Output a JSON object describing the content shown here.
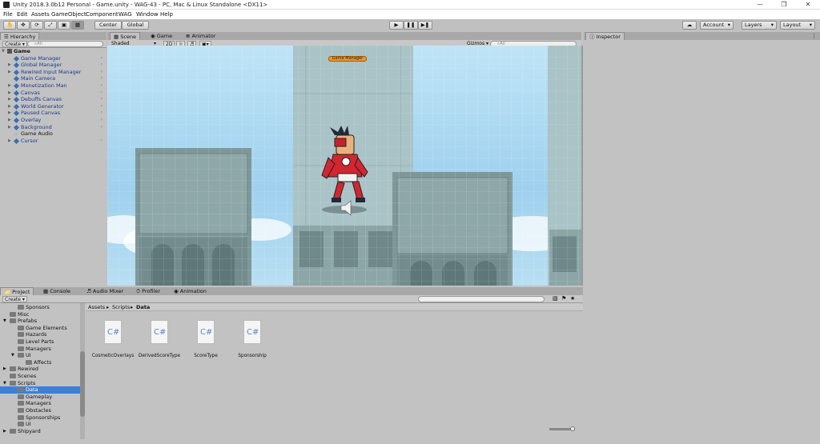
{
  "window": {
    "title": "Unity 2018.3.0b12 Personal - Game.unity - WAG-43 - PC, Mac & Linux Standalone <DX11>"
  },
  "menu": [
    "File",
    "Edit",
    "Assets",
    "GameObject",
    "Component",
    "WAG",
    "Window",
    "Help"
  ],
  "toolbar": {
    "center_label": "Center",
    "global_label": "Global",
    "account_label": "Account",
    "layers_label": "Layers",
    "layout_label": "Layout"
  },
  "hierarchy": {
    "tab": "Hierarchy",
    "create_label": "Create",
    "search_placeholder": "⌕All",
    "root": "Game",
    "items": [
      {
        "label": "Game Manager",
        "arrow": false
      },
      {
        "label": "Global Manager",
        "arrow": true
      },
      {
        "label": "Rewired Input Manager",
        "arrow": true
      },
      {
        "label": "Main Camera",
        "arrow": false
      },
      {
        "label": "Monetization Man",
        "arrow": true
      },
      {
        "label": "Canvas",
        "arrow": true
      },
      {
        "label": "Debuffs Canvas",
        "arrow": true
      },
      {
        "label": "World Generator",
        "arrow": true
      },
      {
        "label": "Paused Canvas",
        "arrow": true
      },
      {
        "label": "Overlay",
        "arrow": true
      },
      {
        "label": "Background",
        "arrow": true
      },
      {
        "label": "Game Audio",
        "arrow": false
      },
      {
        "label": "Cursor",
        "arrow": true
      }
    ]
  },
  "scene": {
    "tabs": [
      "Scene",
      "Game",
      "Animator"
    ],
    "shading": "Shaded",
    "mode_2d": "2D",
    "gizmos_label": "Gizmos",
    "search_placeholder": "⌕All",
    "game_manager_label": "Game Manager"
  },
  "inspector": {
    "tab": "Inspector"
  },
  "project": {
    "tabs": [
      "Project",
      "Console",
      "Audio Mixer",
      "Profiler",
      "Animation"
    ],
    "create_label": "Create",
    "breadcrumb": [
      "Assets",
      "Scripts",
      "Data"
    ],
    "tree": [
      {
        "label": "Sponsors",
        "indent": 1
      },
      {
        "label": "Misc",
        "indent": 0
      },
      {
        "label": "Prefabs",
        "indent": 0,
        "arrow": "▼"
      },
      {
        "label": "Game Elements",
        "indent": 1
      },
      {
        "label": "Hazards",
        "indent": 1
      },
      {
        "label": "Level Parts",
        "indent": 1
      },
      {
        "label": "Managers",
        "indent": 1
      },
      {
        "label": "UI",
        "indent": 1,
        "arrow": "▼"
      },
      {
        "label": "Affects",
        "indent": 2
      },
      {
        "label": "Rewired",
        "indent": 0,
        "arrow": "▶"
      },
      {
        "label": "Scenes",
        "indent": 0
      },
      {
        "label": "Scripts",
        "indent": 0,
        "arrow": "▼"
      },
      {
        "label": "Data",
        "indent": 1,
        "selected": true
      },
      {
        "label": "Gameplay",
        "indent": 1
      },
      {
        "label": "Managers",
        "indent": 1
      },
      {
        "label": "Obstacles",
        "indent": 1
      },
      {
        "label": "Sponsorships",
        "indent": 1
      },
      {
        "label": "UI",
        "indent": 1
      },
      {
        "label": "Shipyard",
        "indent": 0,
        "arrow": "▶"
      }
    ],
    "assets": [
      {
        "icon": "C#",
        "name": "CosmeticOverlays"
      },
      {
        "icon": "C#",
        "name": "DerivedScoreType"
      },
      {
        "icon": "C#",
        "name": "ScoreType"
      },
      {
        "icon": "C#",
        "name": "Sponsorship"
      }
    ]
  }
}
